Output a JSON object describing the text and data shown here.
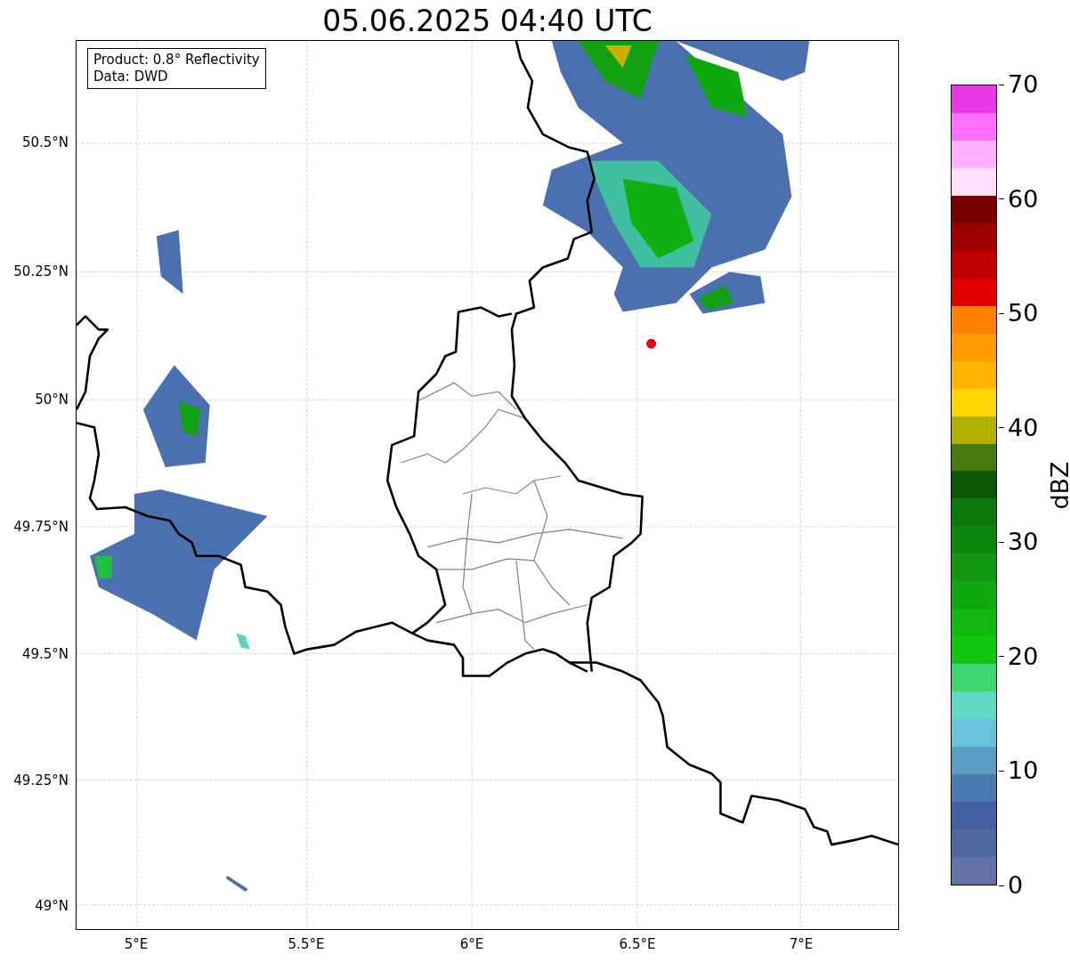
{
  "title": "05.06.2025 04:40 UTC",
  "info_box": [
    "Product: 0.8° Reflectivity",
    "Data: DWD"
  ],
  "map": {
    "lat_ticks": [
      "50.5°N",
      "50.25°N",
      "50°N",
      "49.75°N",
      "49.5°N",
      "49.25°N",
      "49°N"
    ],
    "lon_ticks": [
      "5°E",
      "5.5°E",
      "6°E",
      "6.5°E",
      "7°E"
    ]
  },
  "colorbar": {
    "label": "dBZ",
    "ticks": [
      "70",
      "60",
      "50",
      "40",
      "30",
      "20",
      "10",
      "0"
    ],
    "bins": [
      {
        "color": "#6272a4"
      },
      {
        "color": "#5068a0"
      },
      {
        "color": "#4260a0"
      },
      {
        "color": "#4a7bb0"
      },
      {
        "color": "#5a9ec5"
      },
      {
        "color": "#68c2dc"
      },
      {
        "color": "#60d8c4"
      },
      {
        "color": "#3dd670"
      },
      {
        "color": "#10c810"
      },
      {
        "color": "#10b810"
      },
      {
        "color": "#10a810"
      },
      {
        "color": "#109810"
      },
      {
        "color": "#0c880c"
      },
      {
        "color": "#0a780a"
      },
      {
        "color": "#085808"
      },
      {
        "color": "#457a10"
      },
      {
        "color": "#b0b000"
      },
      {
        "color": "#ffd700"
      },
      {
        "color": "#ffb400"
      },
      {
        "color": "#ff9b00"
      },
      {
        "color": "#ff8000"
      },
      {
        "color": "#e00000"
      },
      {
        "color": "#c00000"
      },
      {
        "color": "#a00000"
      },
      {
        "color": "#780000"
      },
      {
        "color": "#ffe0ff"
      },
      {
        "color": "#ffb0ff"
      },
      {
        "color": "#ff70ff"
      },
      {
        "color": "#e838e8"
      }
    ]
  }
}
